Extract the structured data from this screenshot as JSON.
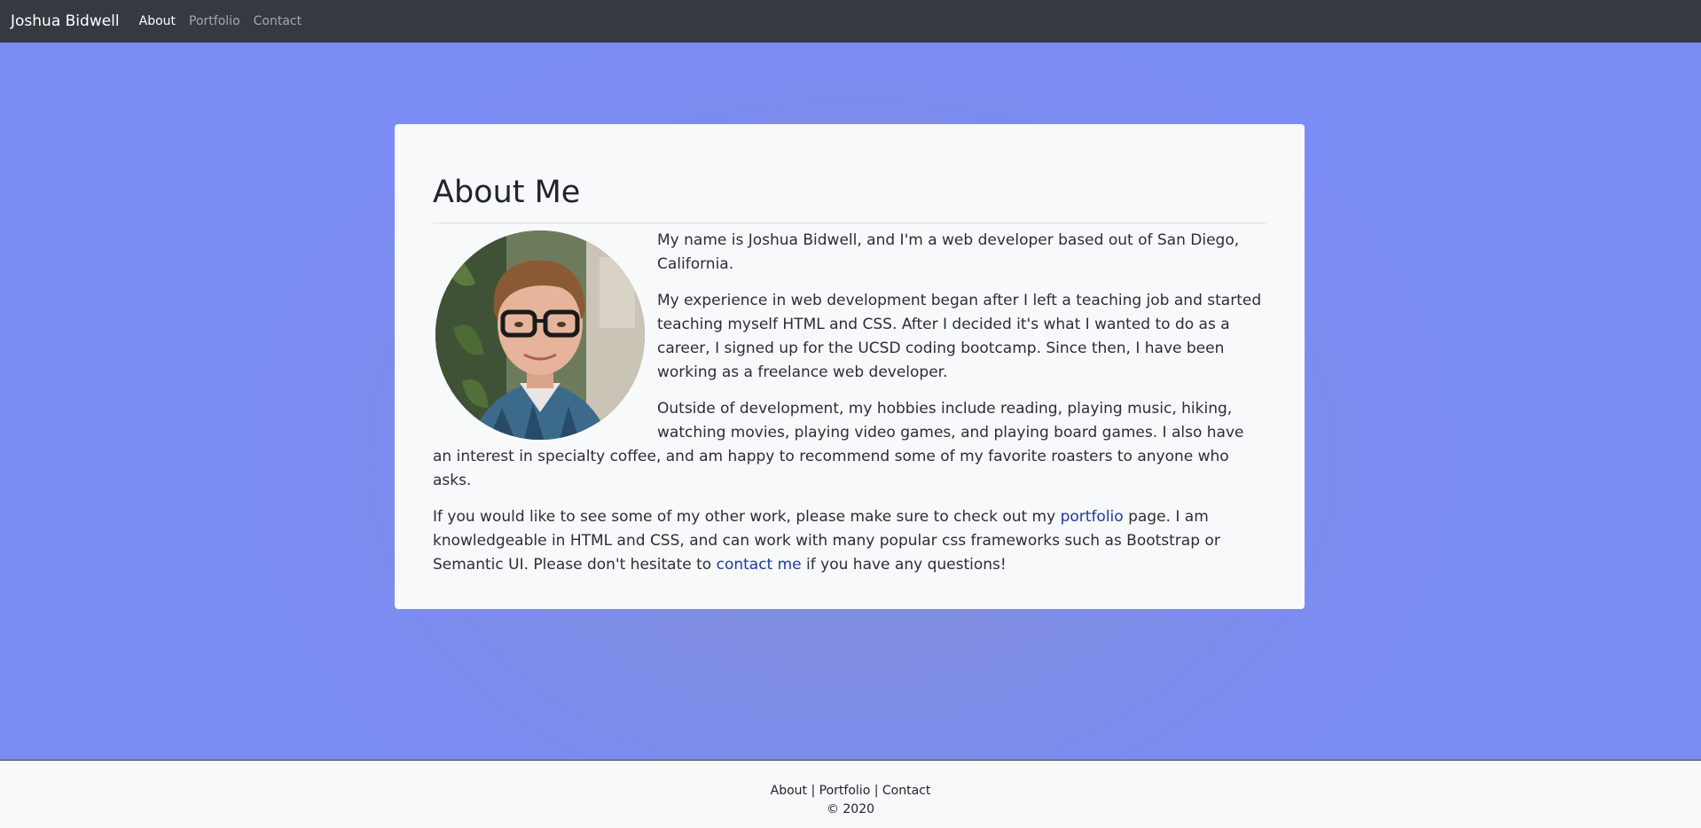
{
  "navbar": {
    "brand": "Joshua Bidwell",
    "links": [
      {
        "label": "About",
        "active": true
      },
      {
        "label": "Portfolio",
        "active": false
      },
      {
        "label": "Contact",
        "active": false
      }
    ]
  },
  "about": {
    "title": "About Me",
    "paragraph_1": "My name is Joshua Bidwell, and I'm a web developer based out of San Diego, California.",
    "paragraph_2": "My experience in web development began after I left a teaching job and started teaching myself HTML and CSS. After I decided it's what I wanted to do as a career, I signed up for the UCSD coding bootcamp. Since then, I have been working as a freelance web developer.",
    "paragraph_3": "Outside of development, my hobbies include reading, playing music, hiking, watching movies, playing video games, and playing board games. I also have an interest in specialty coffee, and am happy to recommend some of my favorite roasters to anyone who asks.",
    "paragraph_4_before": "If you would like to see some of my other work, please make sure to check out my ",
    "paragraph_4_link1": "portfolio",
    "paragraph_4_middle": " page. I am knowledgeable in HTML and CSS, and can work with many popular css frameworks such as Bootstrap or Semantic UI. Please don't hesitate to ",
    "paragraph_4_link2": "contact me",
    "paragraph_4_after": " if you have any questions!"
  },
  "footer": {
    "links": [
      "About",
      "Portfolio",
      "Contact"
    ],
    "separator": " | ",
    "copyright": "© 2020"
  },
  "colors": {
    "navbar_bg": "#343a40",
    "page_bg": "#7b8cf5",
    "card_bg": "#f8f9fa",
    "link": "#1f3a9e"
  }
}
